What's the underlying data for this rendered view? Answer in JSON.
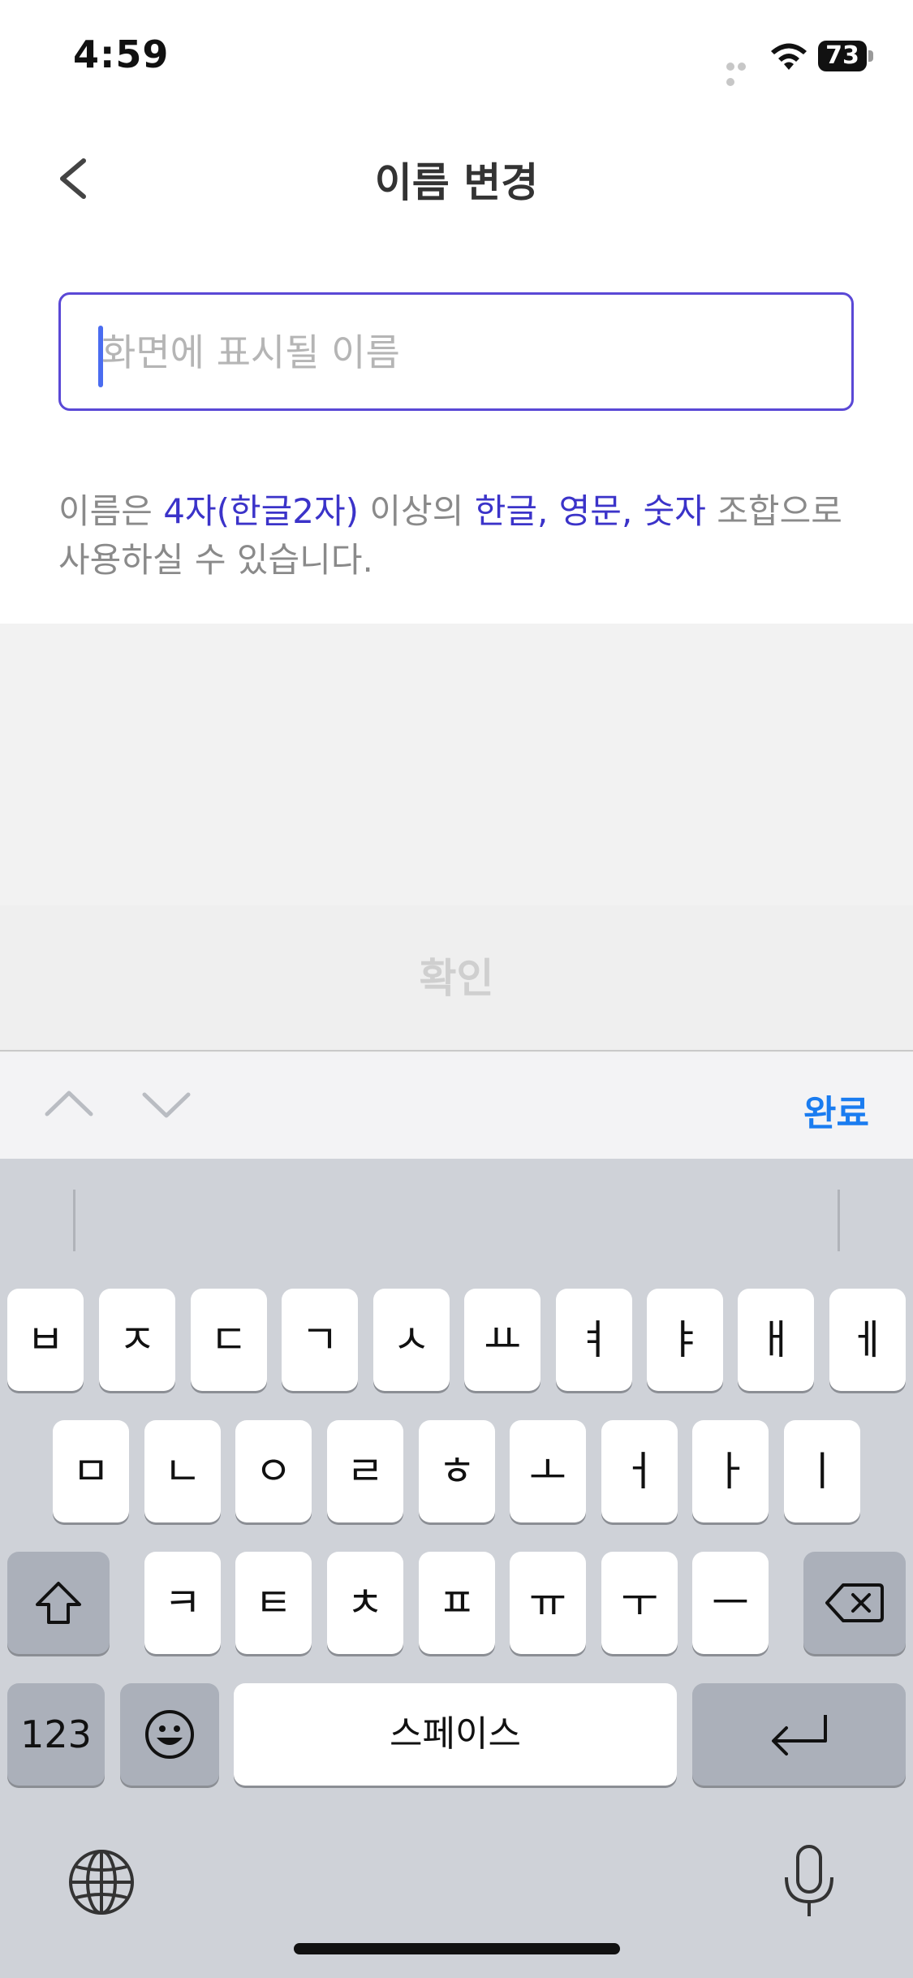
{
  "status_bar": {
    "time": "4:59",
    "battery": "73"
  },
  "header": {
    "title": "이름 변경"
  },
  "name_field": {
    "placeholder": "화면에 표시될 이름",
    "value": ""
  },
  "hint": {
    "part1": "이름은 ",
    "part2": "4자(한글2자)",
    "part3": " 이상의 ",
    "part4": "한글, 영문, 숫자",
    "part5": " 조합으로 사용하실 수 있습니다."
  },
  "confirm_button": {
    "label": "확인"
  },
  "accessory": {
    "done_label": "완료"
  },
  "keyboard": {
    "row1": [
      "ㅂ",
      "ㅈ",
      "ㄷ",
      "ㄱ",
      "ㅅ",
      "ㅛ",
      "ㅕ",
      "ㅑ",
      "ㅐ",
      "ㅔ"
    ],
    "row2": [
      "ㅁ",
      "ㄴ",
      "ㅇ",
      "ㄹ",
      "ㅎ",
      "ㅗ",
      "ㅓ",
      "ㅏ",
      "ㅣ"
    ],
    "row3": [
      "ㅋ",
      "ㅌ",
      "ㅊ",
      "ㅍ",
      "ㅠ",
      "ㅜ",
      "ㅡ"
    ],
    "numbers_label": "123",
    "space_label": "스페이스"
  },
  "colors": {
    "accent": "#5a48d6",
    "highlight": "#3b33c9",
    "done": "#1a7cf0",
    "caret": "#4a6cf0"
  },
  "icons": [
    "back-chevron-icon",
    "wifi-icon",
    "battery-icon",
    "chevron-up-icon",
    "chevron-down-icon",
    "shift-icon",
    "backspace-icon",
    "emoji-icon",
    "return-icon",
    "globe-icon",
    "microphone-icon"
  ]
}
